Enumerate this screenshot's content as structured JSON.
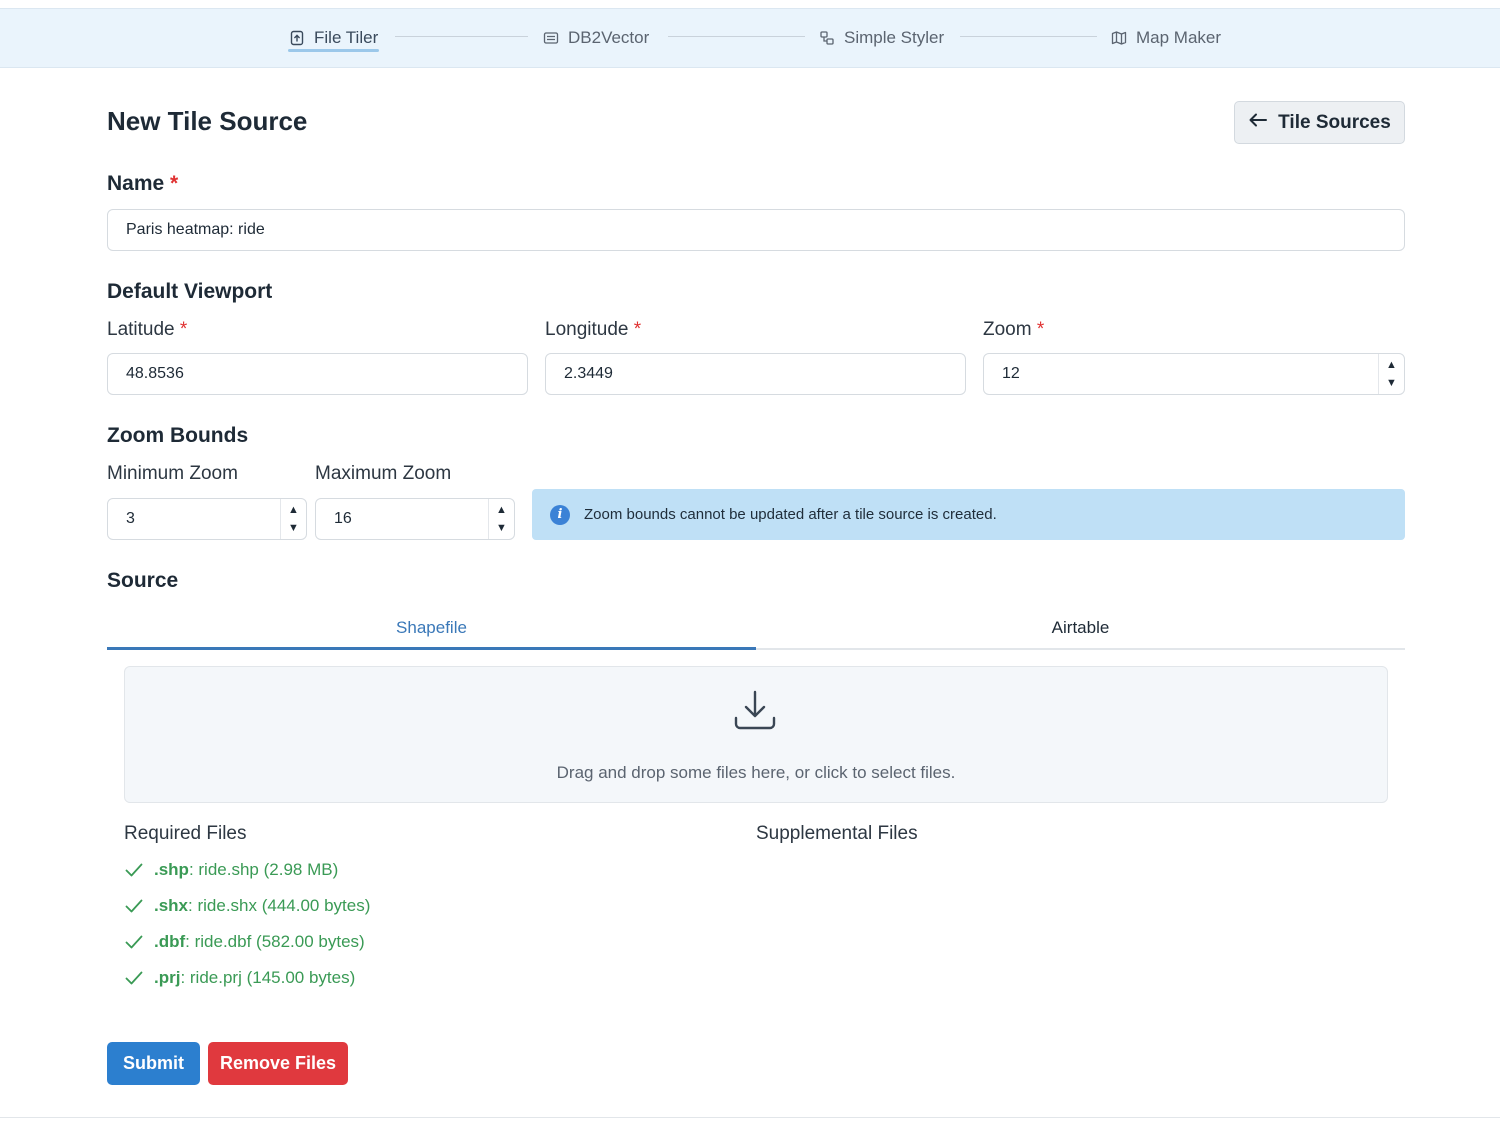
{
  "nav": {
    "steps": [
      {
        "label": "File Tiler",
        "icon": "file-upload-icon"
      },
      {
        "label": "DB2Vector",
        "icon": "database-icon"
      },
      {
        "label": "Simple Styler",
        "icon": "styler-icon"
      },
      {
        "label": "Map Maker",
        "icon": "map-icon"
      }
    ]
  },
  "header": {
    "title": "New Tile Source",
    "back_label": "Tile Sources"
  },
  "form": {
    "name_label": "Name",
    "name_value": "Paris heatmap: ride",
    "required_mark": "*",
    "viewport": {
      "heading": "Default Viewport",
      "latitude_label": "Latitude",
      "latitude_value": "48.8536",
      "longitude_label": "Longitude",
      "longitude_value": "2.3449",
      "zoom_label": "Zoom",
      "zoom_value": "12"
    },
    "zoom_bounds": {
      "heading": "Zoom Bounds",
      "min_label": "Minimum Zoom",
      "min_value": "3",
      "max_label": "Maximum Zoom",
      "max_value": "16",
      "info_text": "Zoom bounds cannot be updated after a tile source is created.",
      "info_icon": "i"
    },
    "source": {
      "heading": "Source",
      "tabs": [
        "Shapefile",
        "Airtable"
      ],
      "dropzone_text": "Drag and drop some files here, or click to select files.",
      "required_heading": "Required Files",
      "supplemental_heading": "Supplemental Files",
      "required_files": [
        {
          "ext": ".shp",
          "detail": ": ride.shp (2.98 MB)"
        },
        {
          "ext": ".shx",
          "detail": ": ride.shx (444.00 bytes)"
        },
        {
          "ext": ".dbf",
          "detail": ": ride.dbf (582.00 bytes)"
        },
        {
          "ext": ".prj",
          "detail": ": ride.prj (145.00 bytes)"
        }
      ]
    }
  },
  "actions": {
    "submit_label": "Submit",
    "remove_label": "Remove Files"
  },
  "colors": {
    "accent": "#2c7fcf",
    "danger": "#e0393e",
    "success": "#3a9a55",
    "info_bg": "#bfe0f6"
  }
}
